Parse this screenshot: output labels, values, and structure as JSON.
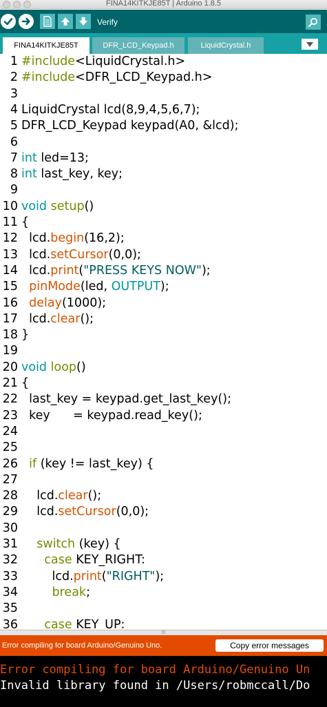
{
  "window": {
    "title": "FINA14KITKJE85T | Arduino 1.8.5"
  },
  "toolbar": {
    "verify_icon": "checkmark-icon",
    "upload_icon": "arrow-right-icon",
    "new_icon": "document-icon",
    "open_icon": "arrow-up-icon",
    "save_icon": "arrow-down-icon",
    "hover_label": "Verify",
    "serial_icon": "magnifier-icon",
    "colors": {
      "bar": "#006468",
      "buttons": "#4db7bb",
      "tabs": "#17a1a5"
    }
  },
  "tabs": [
    {
      "label": "FINA14KITKJE85T",
      "active": true
    },
    {
      "label": "DFR_LCD_Keypad.h",
      "active": false
    },
    {
      "label": "LiquidCrystal.h",
      "active": false
    }
  ],
  "tab_menu_icon": "triangle-down-icon",
  "editor": {
    "lines": [
      {
        "n": "1",
        "tokens": [
          [
            "tp",
            "#include"
          ],
          [
            "",
            "<LiquidCrystal.h>"
          ]
        ]
      },
      {
        "n": "2",
        "tokens": [
          [
            "tp",
            "#include"
          ],
          [
            "",
            "<DFR_LCD_Keypad.h>"
          ]
        ]
      },
      {
        "n": "3",
        "tokens": []
      },
      {
        "n": "4",
        "tokens": [
          [
            "",
            "LiquidCrystal lcd(8,9,4,5,6,7);"
          ]
        ]
      },
      {
        "n": "5",
        "tokens": [
          [
            "",
            "DFR_LCD_Keypad keypad(A0, &lcd);"
          ]
        ]
      },
      {
        "n": "6",
        "tokens": []
      },
      {
        "n": "7",
        "tokens": [
          [
            "kw",
            "int"
          ],
          [
            "",
            " led=13;"
          ]
        ]
      },
      {
        "n": "8",
        "tokens": [
          [
            "kw",
            "int"
          ],
          [
            "",
            " last_key, key;"
          ]
        ]
      },
      {
        "n": "9",
        "tokens": []
      },
      {
        "n": "10",
        "tokens": [
          [
            "kw",
            "void"
          ],
          [
            "",
            " "
          ],
          [
            "tp",
            "setup"
          ],
          [
            "",
            "()"
          ]
        ]
      },
      {
        "n": "11",
        "tokens": [
          [
            "",
            "{"
          ]
        ]
      },
      {
        "n": "12",
        "tokens": [
          [
            "",
            "  lcd."
          ],
          [
            "fn",
            "begin"
          ],
          [
            "",
            "(16,2);"
          ]
        ]
      },
      {
        "n": "13",
        "tokens": [
          [
            "",
            "  lcd."
          ],
          [
            "fn",
            "setCursor"
          ],
          [
            "",
            "(0,0);"
          ]
        ]
      },
      {
        "n": "14",
        "tokens": [
          [
            "",
            "  lcd."
          ],
          [
            "fn",
            "print"
          ],
          [
            "",
            "("
          ],
          [
            "st",
            "\"PRESS KEYS NOW\""
          ],
          [
            "",
            ");"
          ]
        ]
      },
      {
        "n": "15",
        "tokens": [
          [
            "",
            "  "
          ],
          [
            "fn",
            "pinMode"
          ],
          [
            "",
            "(led, "
          ],
          [
            "kw",
            "OUTPUT"
          ],
          [
            "",
            ");"
          ]
        ]
      },
      {
        "n": "16",
        "tokens": [
          [
            "",
            "  "
          ],
          [
            "fn",
            "delay"
          ],
          [
            "",
            "(1000);"
          ]
        ]
      },
      {
        "n": "17",
        "tokens": [
          [
            "",
            "  lcd."
          ],
          [
            "fn",
            "clear"
          ],
          [
            "",
            "();"
          ]
        ]
      },
      {
        "n": "18",
        "tokens": [
          [
            "",
            "}"
          ]
        ]
      },
      {
        "n": "19",
        "tokens": []
      },
      {
        "n": "20",
        "tokens": [
          [
            "kw",
            "void"
          ],
          [
            "",
            " "
          ],
          [
            "tp",
            "loop"
          ],
          [
            "",
            "()"
          ]
        ]
      },
      {
        "n": "21",
        "tokens": [
          [
            "",
            "{"
          ]
        ]
      },
      {
        "n": "22",
        "tokens": [
          [
            "",
            "  last_key = keypad.get_last_key();"
          ]
        ]
      },
      {
        "n": "23",
        "tokens": [
          [
            "",
            "  key      = keypad.read_key();"
          ]
        ]
      },
      {
        "n": "24",
        "tokens": []
      },
      {
        "n": "25",
        "tokens": []
      },
      {
        "n": "26",
        "tokens": [
          [
            "",
            "  "
          ],
          [
            "tp",
            "if"
          ],
          [
            "",
            " (key != last_key) {"
          ]
        ]
      },
      {
        "n": "27",
        "tokens": []
      },
      {
        "n": "28",
        "tokens": [
          [
            "",
            "    lcd."
          ],
          [
            "fn",
            "clear"
          ],
          [
            "",
            "();"
          ]
        ]
      },
      {
        "n": "29",
        "tokens": [
          [
            "",
            "    lcd."
          ],
          [
            "fn",
            "setCursor"
          ],
          [
            "",
            "(0,0);"
          ]
        ]
      },
      {
        "n": "30",
        "tokens": []
      },
      {
        "n": "31",
        "tokens": [
          [
            "",
            "    "
          ],
          [
            "tp",
            "switch"
          ],
          [
            "",
            " (key) {"
          ]
        ]
      },
      {
        "n": "32",
        "tokens": [
          [
            "",
            "      "
          ],
          [
            "tp",
            "case"
          ],
          [
            "",
            " KEY_RIGHT:"
          ]
        ]
      },
      {
        "n": "33",
        "tokens": [
          [
            "",
            "        lcd."
          ],
          [
            "fn",
            "print"
          ],
          [
            "",
            "("
          ],
          [
            "st",
            "\"RIGHT\""
          ],
          [
            "",
            ");"
          ]
        ]
      },
      {
        "n": "34",
        "tokens": [
          [
            "",
            "        "
          ],
          [
            "tp",
            "break"
          ],
          [
            "",
            ";"
          ]
        ]
      },
      {
        "n": "35",
        "tokens": []
      },
      {
        "n": "36",
        "tokens": [
          [
            "",
            "      "
          ],
          [
            "tp",
            "case"
          ],
          [
            "",
            " KEY_UP:"
          ]
        ]
      }
    ],
    "colors": {
      "keyword": "#00979c",
      "function": "#d35400",
      "structure": "#728e00",
      "string": "#005c5f"
    }
  },
  "status": {
    "message": "Error compiling for board Arduino/Genuino Uno.",
    "copy_button": "Copy error messages",
    "color": "#e34c00"
  },
  "console": {
    "line1": "Error compiling for board Arduino/Genuino Un",
    "line2": "Invalid library found in /Users/robmccall/Do"
  }
}
